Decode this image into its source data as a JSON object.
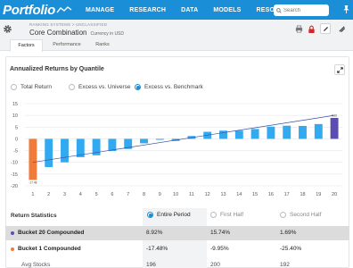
{
  "app": {
    "logo_text": "Portfolio",
    "nav": [
      "MANAGE",
      "RESEARCH",
      "DATA",
      "MODELS",
      "RESOURCES"
    ],
    "search_placeholder": "Search",
    "brand_color": "#1a8fd8"
  },
  "header": {
    "breadcrumb": "RANKING SYSTEMS > UNCLASSIFIED",
    "title": "Core Combination",
    "subtitle": "Currency in USD"
  },
  "tabs": [
    {
      "label": "Factors",
      "active": true
    },
    {
      "label": "Performance",
      "active": false
    },
    {
      "label": "Ranks",
      "active": false
    }
  ],
  "card": {
    "title": "Annualized Returns by Quantile",
    "options": [
      {
        "label": "Total Return",
        "selected": false
      },
      {
        "label": "Excess vs. Universe",
        "selected": false
      },
      {
        "label": "Excess vs. Benchmark",
        "selected": true
      }
    ]
  },
  "chart_data": {
    "type": "bar",
    "categories": [
      "1",
      "2",
      "3",
      "4",
      "5",
      "6",
      "7",
      "8",
      "9",
      "10",
      "11",
      "12",
      "13",
      "14",
      "15",
      "16",
      "17",
      "18",
      "19",
      "20"
    ],
    "values": [
      -17.48,
      -12.0,
      -10.0,
      -7.8,
      -7.0,
      -5.2,
      -4.3,
      -1.9,
      -0.4,
      -0.9,
      1.2,
      3.0,
      3.5,
      3.5,
      4.2,
      5.2,
      5.6,
      5.5,
      6.3,
      8.92
    ],
    "first_label": "-17.48",
    "last_label": "8.92",
    "trend_start": -10.0,
    "trend_end": 10.0,
    "ylim": [
      -20,
      15
    ],
    "yticks": [
      15,
      10,
      5,
      0,
      -5,
      -10,
      -15,
      -20
    ],
    "colors": {
      "bar": "#33a9ef",
      "first": "#f07b3a",
      "last": "#5a4fb0",
      "trend": "#3d4fa0",
      "grid": "#e6e8eb"
    }
  },
  "table": {
    "label": "Return Statistics",
    "columns": [
      {
        "label": "Entire Period",
        "selected": true
      },
      {
        "label": "First Half",
        "selected": false
      },
      {
        "label": "Second Half",
        "selected": false
      }
    ],
    "rows": [
      {
        "name": "Bucket 20 Compounded",
        "dot": "#5a4fb0",
        "values": [
          "8.92%",
          "15.74%",
          "1.69%"
        ]
      },
      {
        "name": "Bucket 1 Compounded",
        "dot": "#f07b3a",
        "values": [
          "-17.48%",
          "-9.95%",
          "-25.40%"
        ]
      },
      {
        "name": "Avg Stocks",
        "dot": "",
        "values": [
          "196",
          "200",
          "192"
        ]
      }
    ]
  }
}
